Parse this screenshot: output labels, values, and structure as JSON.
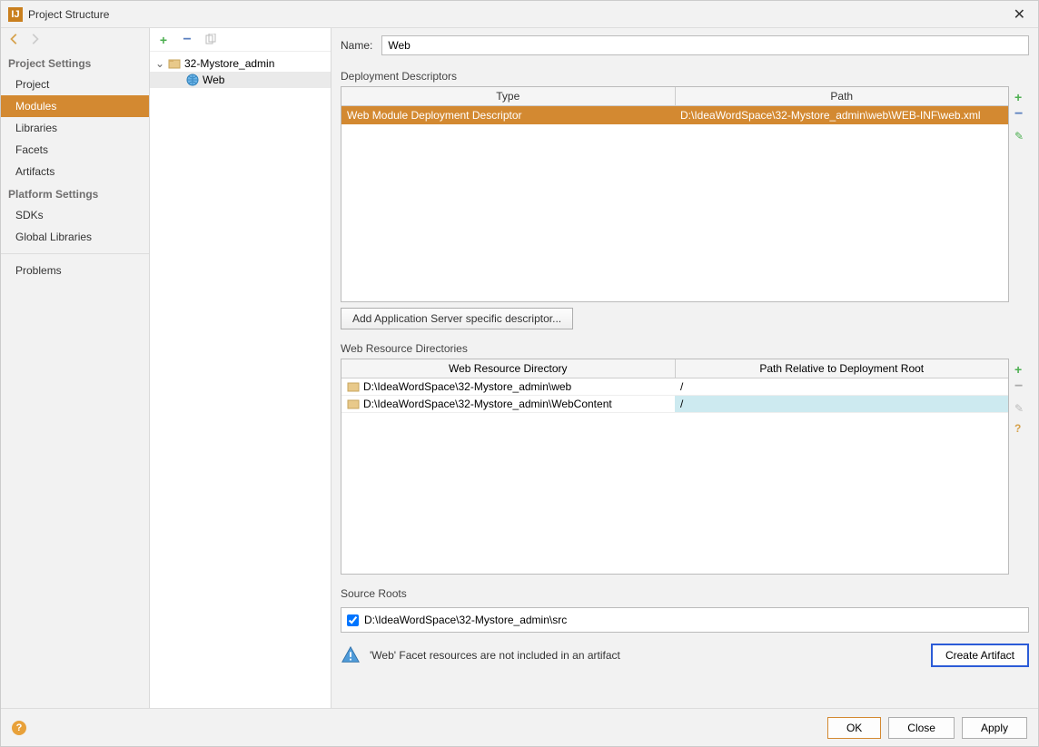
{
  "titlebar": {
    "title": "Project Structure"
  },
  "sidebar": {
    "section1": "Project Settings",
    "items1": [
      "Project",
      "Modules",
      "Libraries",
      "Facets",
      "Artifacts"
    ],
    "selected1": 1,
    "section2": "Platform Settings",
    "items2": [
      "SDKs",
      "Global Libraries"
    ],
    "section3_items": [
      "Problems"
    ]
  },
  "tree": {
    "root": "32-Mystore_admin",
    "child": "Web"
  },
  "form": {
    "name_label": "Name:",
    "name_value": "Web"
  },
  "dd": {
    "heading": "Deployment Descriptors",
    "col_type": "Type",
    "col_path": "Path",
    "rows": [
      {
        "type": "Web Module Deployment Descriptor",
        "path": "D:\\IdeaWordSpace\\32-Mystore_admin\\web\\WEB-INF\\web.xml"
      }
    ],
    "add_button": "Add Application Server specific descriptor..."
  },
  "wrd": {
    "heading": "Web Resource Directories",
    "col_dir": "Web Resource Directory",
    "col_rel": "Path Relative to Deployment Root",
    "rows": [
      {
        "dir": "D:\\IdeaWordSpace\\32-Mystore_admin\\web",
        "rel": "/"
      },
      {
        "dir": "D:\\IdeaWordSpace\\32-Mystore_admin\\WebContent",
        "rel": "/"
      }
    ]
  },
  "src": {
    "heading": "Source Roots",
    "path": "D:\\IdeaWordSpace\\32-Mystore_admin\\src"
  },
  "warning": {
    "msg": "'Web' Facet resources are not included in an artifact",
    "button": "Create Artifact"
  },
  "footer": {
    "ok": "OK",
    "close": "Close",
    "apply": "Apply"
  }
}
